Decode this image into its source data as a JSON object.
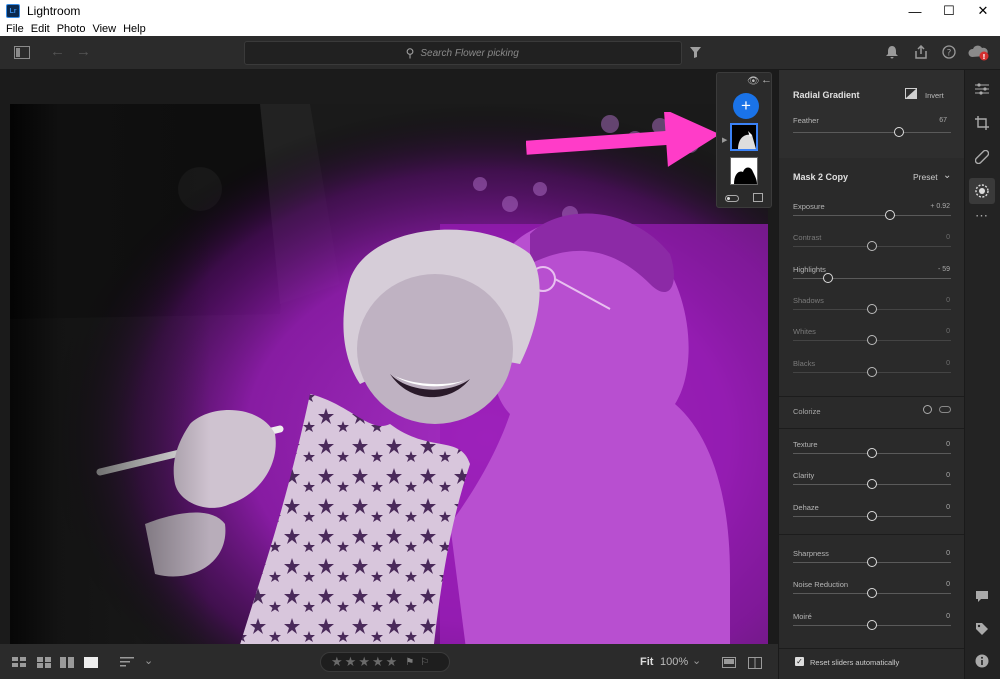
{
  "window": {
    "title": "Lightroom",
    "app_icon_text": "Lr"
  },
  "menu": [
    "File",
    "Edit",
    "Photo",
    "View",
    "Help"
  ],
  "search": {
    "placeholder": "Search Flower picking"
  },
  "viewer": {
    "image_description": "Black and white photo of a smiling woman in a star-patterned scarf holding a white stick, with a person kissing her cheek; radial mask overlay shown in purple"
  },
  "masks_panel": {
    "add_label": "+",
    "masks": [
      {
        "icon": "radial-gradient-mask",
        "selected": true
      },
      {
        "icon": "subject-mask",
        "selected": false
      }
    ]
  },
  "radial_gradient": {
    "title": "Radial Gradient",
    "invert_label": "Invert",
    "feather_label": "Feather",
    "feather_value": "67",
    "feather_level": 0.67
  },
  "mask_group": {
    "title": "Mask 2 Copy",
    "preset_label": "Preset",
    "sliders": [
      {
        "label": "Exposure",
        "value": "+ 0.92",
        "level": 0.615,
        "active": true
      },
      {
        "label": "Contrast",
        "value": "0",
        "level": 0.5,
        "active": false
      },
      {
        "label": "Highlights",
        "value": "- 59",
        "level": 0.22,
        "active": true
      },
      {
        "label": "Shadows",
        "value": "0",
        "level": 0.5,
        "active": false
      },
      {
        "label": "Whites",
        "value": "0",
        "level": 0.5,
        "active": false
      },
      {
        "label": "Blacks",
        "value": "0",
        "level": 0.5,
        "active": false
      }
    ],
    "colorize_label": "Colorize",
    "sliders2": [
      {
        "label": "Texture",
        "value": "0",
        "level": 0.5
      },
      {
        "label": "Clarity",
        "value": "0",
        "level": 0.5
      },
      {
        "label": "Dehaze",
        "value": "0",
        "level": 0.5
      }
    ],
    "sliders3": [
      {
        "label": "Sharpness",
        "value": "0",
        "level": 0.5
      },
      {
        "label": "Noise Reduction",
        "value": "0",
        "level": 0.5
      },
      {
        "label": "Moiré",
        "value": "0",
        "level": 0.5
      }
    ],
    "reset_label": "Reset sliders automatically",
    "reset_checked": true
  },
  "bottom": {
    "fit_label": "Fit",
    "zoom_label": "100%",
    "stars": 5,
    "rating": 0
  },
  "colors": {
    "accent": "#1a73e8",
    "mask_overlay": "#a020c0",
    "annotation_arrow": "#ff3cc8",
    "panel_bg": "#2a2a2a"
  },
  "icons": {
    "strip": [
      "edit-sliders-icon",
      "crop-icon",
      "healing-icon",
      "masking-icon",
      "more-icon",
      "comment-icon",
      "tag-icon",
      "info-icon"
    ],
    "toolbar": [
      "panel-toggle-icon",
      "back-arrow-icon",
      "forward-arrow-icon",
      "search-icon",
      "filter-icon",
      "notification-bell-icon",
      "share-icon",
      "help-icon",
      "cloud-sync-icon"
    ]
  }
}
